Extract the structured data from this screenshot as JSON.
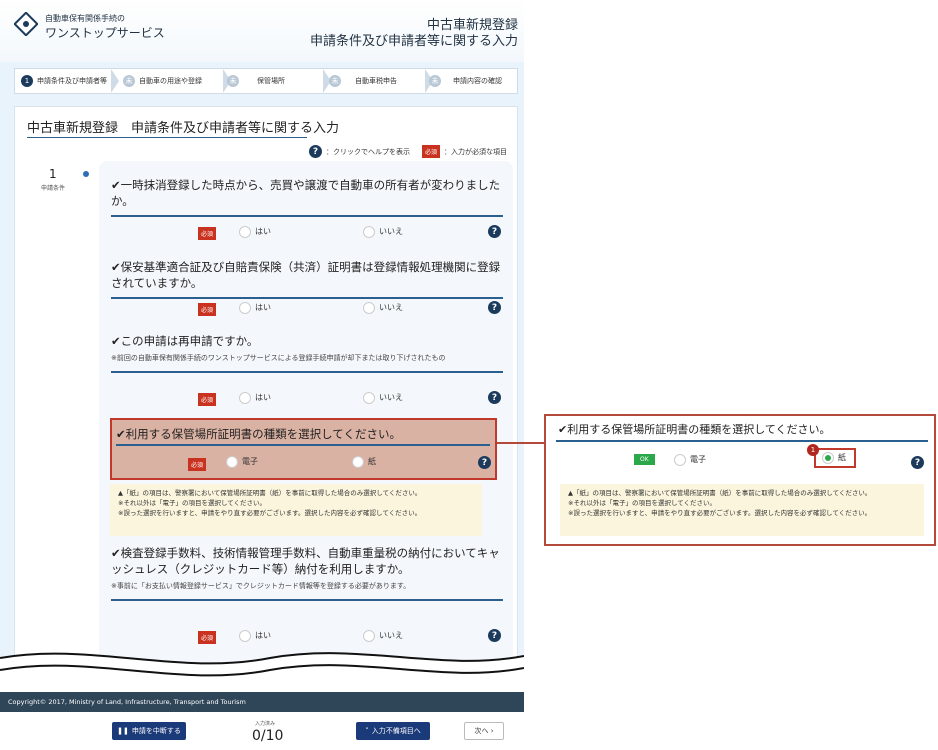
{
  "header": {
    "logo_small": "自動車保有関係手続の",
    "logo_big": "ワンストップサービス",
    "title_line1": "中古車新規登録",
    "title_line2": "申請条件及び申請者等に関する入力"
  },
  "steps": [
    {
      "num": "1",
      "label": "申請条件及び申請者等"
    },
    {
      "num": "未",
      "label": "自動車の用途や登録"
    },
    {
      "num": "未",
      "label": "保管場所"
    },
    {
      "num": "未",
      "label": "自動車税申告"
    },
    {
      "num": "未",
      "label": "申請内容の確認"
    }
  ],
  "panel": {
    "page_title": "中古車新規登録　申請条件及び申請者等に関する入力",
    "help_legend": "：クリックでヘルプを表示",
    "req_label": "必須",
    "req_legend": "：入力が必須な項目",
    "side_num": "1",
    "side_label": "申請条件"
  },
  "questions": {
    "q1": {
      "text": "✔一時抹消登録した時点から、売買や譲渡で自動車の所有者が変わりましたか。",
      "yes": "はい",
      "no": "いいえ"
    },
    "q2": {
      "text": "✔保安基準適合証及び自賠責保険（共済）証明書は登録情報処理機関に登録されていますか。",
      "yes": "はい",
      "no": "いいえ"
    },
    "q3": {
      "text": "✔この申請は再申請ですか。",
      "note": "※前回の自動車保有関係手続のワンストップサービスによる登録手続申請が却下または取り下げされたもの",
      "yes": "はい",
      "no": "いいえ"
    },
    "q4": {
      "text": "✔利用する保管場所証明書の種類を選択してください。",
      "opt1": "電子",
      "opt2": "紙"
    },
    "q5": {
      "text": "✔検査登録手数料、技術情報管理手数料、自動車重量税の納付においてキャッシュレス（クレジットカード等）納付を利用しますか。",
      "note": "※事前に「お支払い情報登録サービス」でクレジットカード情報等を登録する必要があります。",
      "yes": "はい",
      "no": "いいえ"
    }
  },
  "warning": {
    "line1": "▲「紙」の項目は、警察署において保管場所証明書（紙）を事前に取得した場合のみ選択してください。",
    "line2": "※それ以外は「電子」の項目を選択してください。",
    "line3": "※誤った選択を行いますと、申請をやり直す必要がございます。選択した内容を必ず確認してください。"
  },
  "zoom": {
    "text": "✔利用する保管場所証明書の種類を選択してください。",
    "ok_label": "OK",
    "opt1": "電子",
    "opt2": "紙",
    "badge": "1"
  },
  "footer": {
    "copyright": "Copyright© 2017, Ministry of Land, Infrastructure, Transport and Tourism"
  },
  "bottombar": {
    "suspend": "申請を中断する",
    "progress_label": "入力済み",
    "progress_value": "0/10",
    "to_missing": "入力不備項目へ",
    "next": "次へ ›"
  },
  "colors": {
    "accent": "#1b3a5c",
    "required": "#c8321e",
    "ok": "#2aa84a",
    "highlight_border": "#c0392b"
  }
}
